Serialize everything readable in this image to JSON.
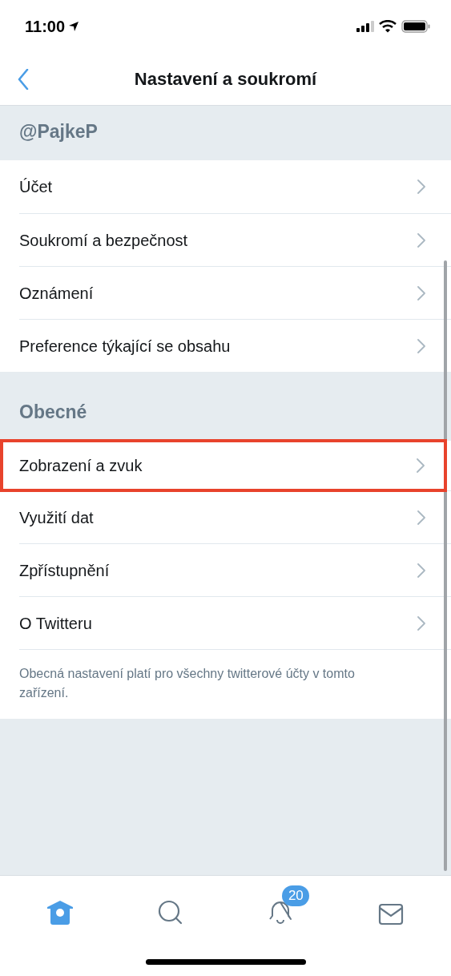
{
  "status_bar": {
    "time": "11:00"
  },
  "nav": {
    "title": "Nastavení a soukromí"
  },
  "sections": [
    {
      "header": "@PajkeP",
      "items": [
        {
          "label": "Účet",
          "highlighted": false
        },
        {
          "label": "Soukromí a bezpečnost",
          "highlighted": false
        },
        {
          "label": "Oznámení",
          "highlighted": false
        },
        {
          "label": "Preference týkající se obsahu",
          "highlighted": false
        }
      ]
    },
    {
      "header": "Obecné",
      "items": [
        {
          "label": "Zobrazení a zvuk",
          "highlighted": true
        },
        {
          "label": "Využití dat",
          "highlighted": false
        },
        {
          "label": "Zpřístupnění",
          "highlighted": false
        },
        {
          "label": "O Twitteru",
          "highlighted": false
        }
      ],
      "note": "Obecná nastavení platí pro všechny twitterové účty v tomto zařízení."
    }
  ],
  "tab_bar": [
    {
      "kind": "home",
      "selected": true
    },
    {
      "kind": "search",
      "selected": false
    },
    {
      "kind": "notifications",
      "selected": false,
      "badge": "20"
    },
    {
      "kind": "messages",
      "selected": false
    }
  ]
}
